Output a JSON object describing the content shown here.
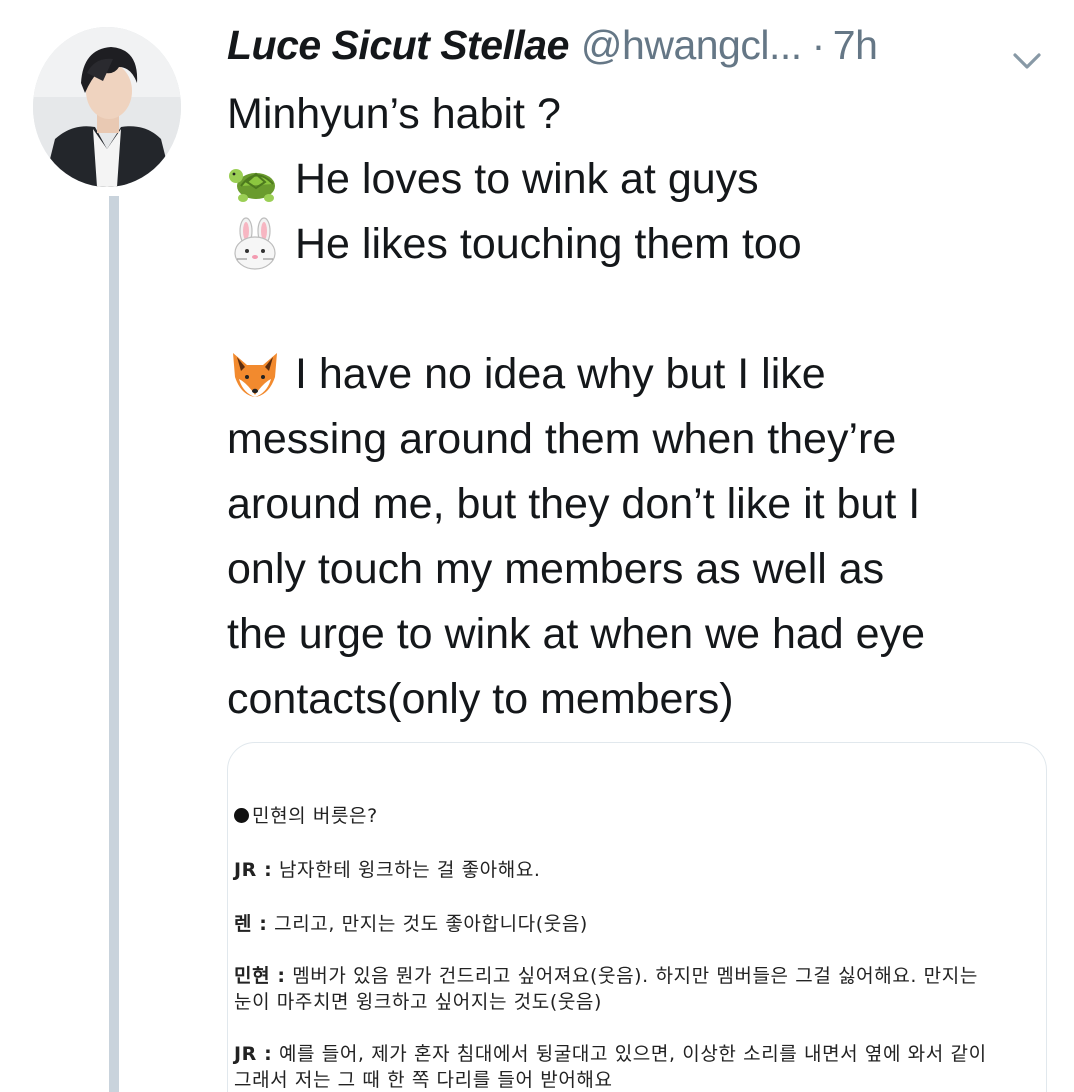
{
  "tweet": {
    "display_name": "Luce Sicut Stellae",
    "handle": "@hwangcl...",
    "separator": "·",
    "time": "7h",
    "line1": "Minhyun’s habit ?",
    "line2_emoji": "turtle-emoji",
    "line2": "He loves to wink at guys",
    "line3_emoji": "rabbit-face-emoji",
    "line3": "He likes touching them too",
    "para_emoji": "fox-face-emoji",
    "para_lines": [
      "I have no idea why but I like",
      "messing around them when they’re",
      "around me, but they don’t like it but I",
      "only touch my members as well as",
      "the urge to wink at when we had eye",
      "contacts(only to members)"
    ]
  },
  "media_doc": {
    "title": "민현의 버릇은?",
    "l1_spk": "JR :",
    "l1": " 남자한테 윙크하는 걸 좋아해요.",
    "l2_spk": "렌 :",
    "l2": " 그리고, 만지는 것도 좋아합니다(웃음)",
    "l3_spk": "민현 :",
    "l3": " 멤버가 있음 뭔가 건드리고 싶어져요(웃음). 하지만 멤버들은 그걸 싫어해요. 만지는",
    "l4": "눈이 마주치면 윙크하고 싶어지는 것도(웃음)",
    "l5_spk": "JR :",
    "l5": " 예를 들어, 제가 혼자 침대에서 뒹굴대고 있으면, 이상한 소리를 내면서 옆에 와서 같이",
    "l6": "그래서 저는 그 때 한 쪽 다리를 들어 받어해요"
  },
  "colors": {
    "text": "#14171a",
    "secondary": "#657786",
    "thread_line": "#c9d3dc",
    "card_border": "#e1e8ed"
  }
}
